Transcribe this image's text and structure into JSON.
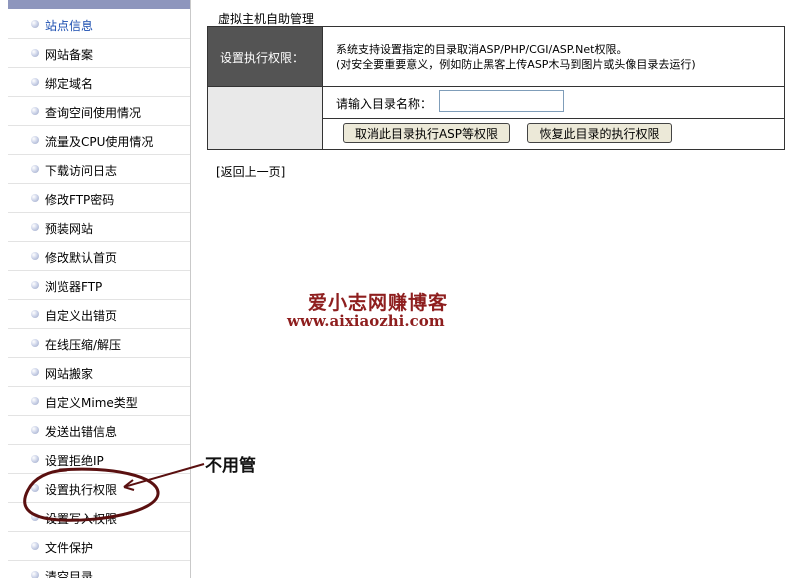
{
  "sidebar": {
    "items": [
      {
        "label": "站点信息"
      },
      {
        "label": "网站备案"
      },
      {
        "label": "绑定域名"
      },
      {
        "label": "查询空间使用情况"
      },
      {
        "label": "流量及CPU使用情况"
      },
      {
        "label": "下载访问日志"
      },
      {
        "label": "修改FTP密码"
      },
      {
        "label": "预装网站"
      },
      {
        "label": "修改默认首页"
      },
      {
        "label": "浏览器FTP"
      },
      {
        "label": "自定义出错页"
      },
      {
        "label": "在线压缩/解压"
      },
      {
        "label": "网站搬家"
      },
      {
        "label": "自定义Mime类型"
      },
      {
        "label": "发送出错信息"
      },
      {
        "label": "设置拒绝IP"
      },
      {
        "label": "设置执行权限"
      },
      {
        "label": "设置写入权限"
      },
      {
        "label": "文件保护"
      },
      {
        "label": "清空目录"
      }
    ]
  },
  "main": {
    "title": "虚拟主机自助管理",
    "panel": {
      "label": "设置执行权限：",
      "description_line1": "系统支持设置指定的目录取消ASP/PHP/CGI/ASP.Net权限。",
      "description_line2": "(对安全要重要意义，例如防止黑客上传ASP木马到图片或头像目录去运行)",
      "input_prompt": "请输入目录名称：",
      "input_value": "",
      "cancel_button": "取消此目录执行ASP等权限",
      "restore_button": "恢复此目录的执行权限"
    },
    "back_link": "[返回上一页]"
  },
  "watermark": {
    "title": "爱小志网赚博客",
    "url": "www.aixiaozhi.com"
  },
  "annotation": {
    "text": "不用管"
  },
  "colors": {
    "sidebar_header": "#8e96bd",
    "panel_label_bg": "#545454",
    "watermark": "#8e1e1e",
    "annotation": "#5a1010"
  }
}
